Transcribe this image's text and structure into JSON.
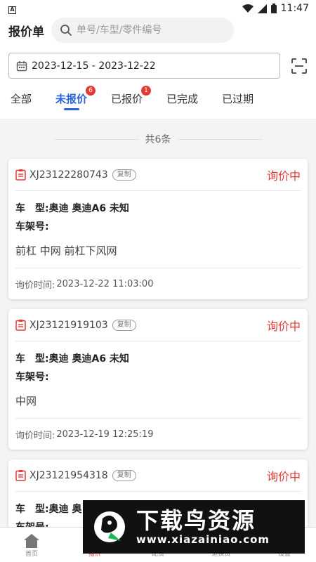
{
  "status_bar": {
    "left_icon": "A",
    "time": "11:47"
  },
  "header": {
    "title": "报价单",
    "search_placeholder": "单号/车型/零件编号"
  },
  "date_range": {
    "value": "2023-12-15 - 2023-12-22"
  },
  "tabs": [
    {
      "label": "全部",
      "badge": ""
    },
    {
      "label": "未报价",
      "badge": "6"
    },
    {
      "label": "已报价",
      "badge": "1"
    },
    {
      "label": "已完成",
      "badge": ""
    },
    {
      "label": "已过期",
      "badge": ""
    }
  ],
  "count_text": "共6条",
  "cards": [
    {
      "order_no": "XJ23122280743",
      "copy_label": "复制",
      "status": "询价中",
      "model_label": "车　型:",
      "model_value": "奥迪 奥迪A6 未知",
      "vin_label": "车架号:",
      "parts": "前杠  中网  前杠下风网",
      "time_label": "询价时间:",
      "time_value": "2023-12-22 11:03:00"
    },
    {
      "order_no": "XJ23121919103",
      "copy_label": "复制",
      "status": "询价中",
      "model_label": "车　型:",
      "model_value": "奥迪 奥迪A6 未知",
      "vin_label": "车架号:",
      "parts": "中网",
      "time_label": "询价时间:",
      "time_value": "2023-12-19 12:25:19"
    },
    {
      "order_no": "XJ23121954318",
      "copy_label": "复制",
      "status": "询价中",
      "model_label": "车　型:",
      "model_value": "奥迪 奥",
      "vin_label": "车架号:"
    }
  ],
  "bottom_nav": [
    {
      "label": "首页"
    },
    {
      "label": "报价"
    },
    {
      "label": "配货"
    },
    {
      "label": "退换货"
    },
    {
      "label": "设置"
    }
  ],
  "watermark": {
    "text": "下载鸟资源",
    "url": "www.xiazainiao.com"
  },
  "colors": {
    "accent": "#2a62d8",
    "status_red": "#e53935"
  }
}
